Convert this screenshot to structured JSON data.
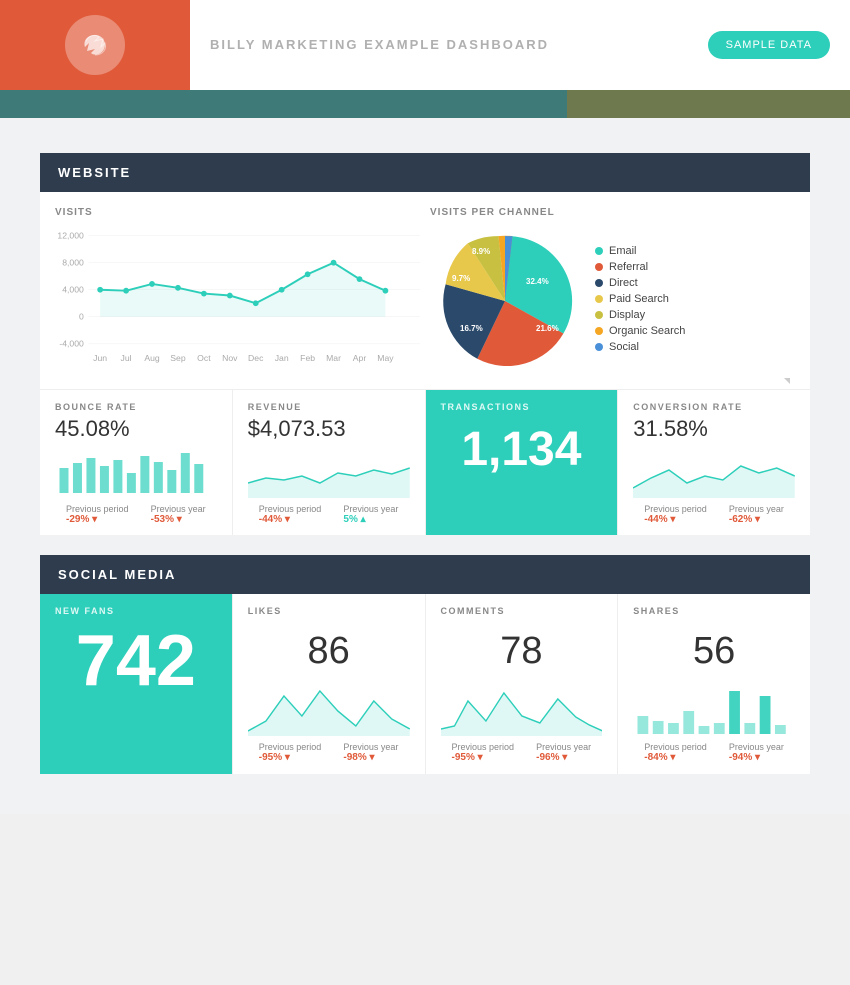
{
  "header": {
    "title": "BILLY MARKETING EXAMPLE DASHBOARD",
    "button_label": "SAMPLE DATA",
    "logo_color": "#e05a3a"
  },
  "website_section": {
    "title": "WEBSITE",
    "visits": {
      "label": "VISITS",
      "y_labels": [
        "12,000",
        "8,000",
        "4,000",
        "0",
        "-4,000"
      ],
      "x_labels": [
        "Jun",
        "Jul",
        "Aug",
        "Sep",
        "Oct",
        "Nov",
        "Dec",
        "Jan",
        "Feb",
        "Mar",
        "Apr",
        "May"
      ]
    },
    "visits_per_channel": {
      "label": "VISITS PER CHANNEL",
      "legend": [
        {
          "name": "Email",
          "color": "#2dcfba",
          "pct": 32.4
        },
        {
          "name": "Referral",
          "color": "#e05a3a",
          "pct": 21.6
        },
        {
          "name": "Direct",
          "color": "#2b4a6b",
          "pct": 16.7
        },
        {
          "name": "Paid Search",
          "color": "#e8b84b",
          "pct": 9.7
        },
        {
          "name": "Display",
          "color": "#d4c84a",
          "pct": 8.9
        },
        {
          "name": "Organic Search",
          "color": "#f5a623",
          "pct": 5.0
        },
        {
          "name": "Social",
          "color": "#4a90d9",
          "pct": 5.7
        }
      ]
    },
    "stats": [
      {
        "id": "bounce-rate",
        "title": "BOUNCE RATE",
        "value": "45.08%",
        "highlight": false,
        "previous_period": {
          "label": "Previous period",
          "value": "-29%",
          "positive": false
        },
        "previous_year": {
          "label": "Previous year",
          "value": "-53%",
          "positive": false
        }
      },
      {
        "id": "revenue",
        "title": "REVENUE",
        "value": "$4,073.53",
        "highlight": false,
        "previous_period": {
          "label": "Previous period",
          "value": "-44%",
          "positive": false
        },
        "previous_year": {
          "label": "Previous year",
          "value": "5%",
          "positive": true
        }
      },
      {
        "id": "transactions",
        "title": "TRANSACTIONS",
        "value": "1,134",
        "highlight": true,
        "previous_period": null,
        "previous_year": null
      },
      {
        "id": "conversion-rate",
        "title": "CONVERSION RATE",
        "value": "31.58%",
        "highlight": false,
        "previous_period": {
          "label": "Previous period",
          "value": "-44%",
          "positive": false
        },
        "previous_year": {
          "label": "Previous year",
          "value": "-62%",
          "positive": false
        }
      }
    ]
  },
  "social_section": {
    "title": "SOCIAL MEDIA",
    "cards": [
      {
        "id": "new-fans",
        "title": "NEW FANS",
        "value": "742",
        "highlight": true,
        "previous_period": null,
        "previous_year": null
      },
      {
        "id": "likes",
        "title": "LIKES",
        "value": "86",
        "highlight": false,
        "previous_period": {
          "label": "Previous period",
          "value": "-95%",
          "positive": false
        },
        "previous_year": {
          "label": "Previous year",
          "value": "-98%",
          "positive": false
        }
      },
      {
        "id": "comments",
        "title": "COMMENTS",
        "value": "78",
        "highlight": false,
        "previous_period": {
          "label": "Previous period",
          "value": "-95%",
          "positive": false
        },
        "previous_year": {
          "label": "Previous year",
          "value": "-96%",
          "positive": false
        }
      },
      {
        "id": "shares",
        "title": "SHARES",
        "value": "56",
        "highlight": false,
        "previous_period": {
          "label": "Previous period",
          "value": "-84%",
          "positive": false
        },
        "previous_year": {
          "label": "Previous year",
          "value": "-94%",
          "positive": false
        }
      }
    ]
  }
}
